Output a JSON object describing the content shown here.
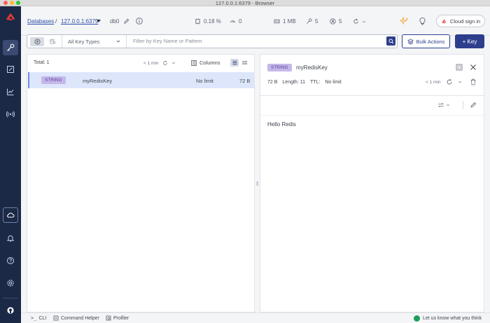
{
  "window": {
    "title": "127.0.0.1:6379 - Browser"
  },
  "header": {
    "databases_link": "Databases",
    "separator": "/",
    "connection": "127.0.0.1:6379",
    "db": "db0",
    "stats": {
      "cpu": "0.18 %",
      "commands": "0",
      "memory": "1 MB",
      "keys": "5",
      "clients": "5"
    },
    "cloud_signin": "Cloud sign in"
  },
  "toolbar": {
    "key_type": "All Key Types",
    "search_placeholder": "Filter by Key Name or Pattern",
    "bulk_actions": "Bulk Actions",
    "add_key": "+ Key"
  },
  "list": {
    "total": "Total: 1",
    "refresh_age": "< 1 min",
    "columns_label": "Columns",
    "rows": [
      {
        "type": "STRING",
        "name": "myRedisKey",
        "ttl": "No limit",
        "size": "72 B"
      }
    ]
  },
  "detail": {
    "type": "STRING",
    "name": "myRedisKey",
    "size": "72 B",
    "length": "Length: 11",
    "ttl_label": "TTL:",
    "ttl_value": "No limit",
    "refresh_age": "< 1 min",
    "value": "Hello Redis"
  },
  "footer": {
    "cli": "CLI",
    "command_helper": "Command Helper",
    "profiler": "Profiler",
    "feedback": "Let us know what you think"
  },
  "colors": {
    "nav_bg": "#1c2946",
    "brand_red": "#dc382d",
    "primary": "#2d3f8c",
    "tag_bg": "#c5b7e9",
    "row_selected": "#dde6fb"
  }
}
